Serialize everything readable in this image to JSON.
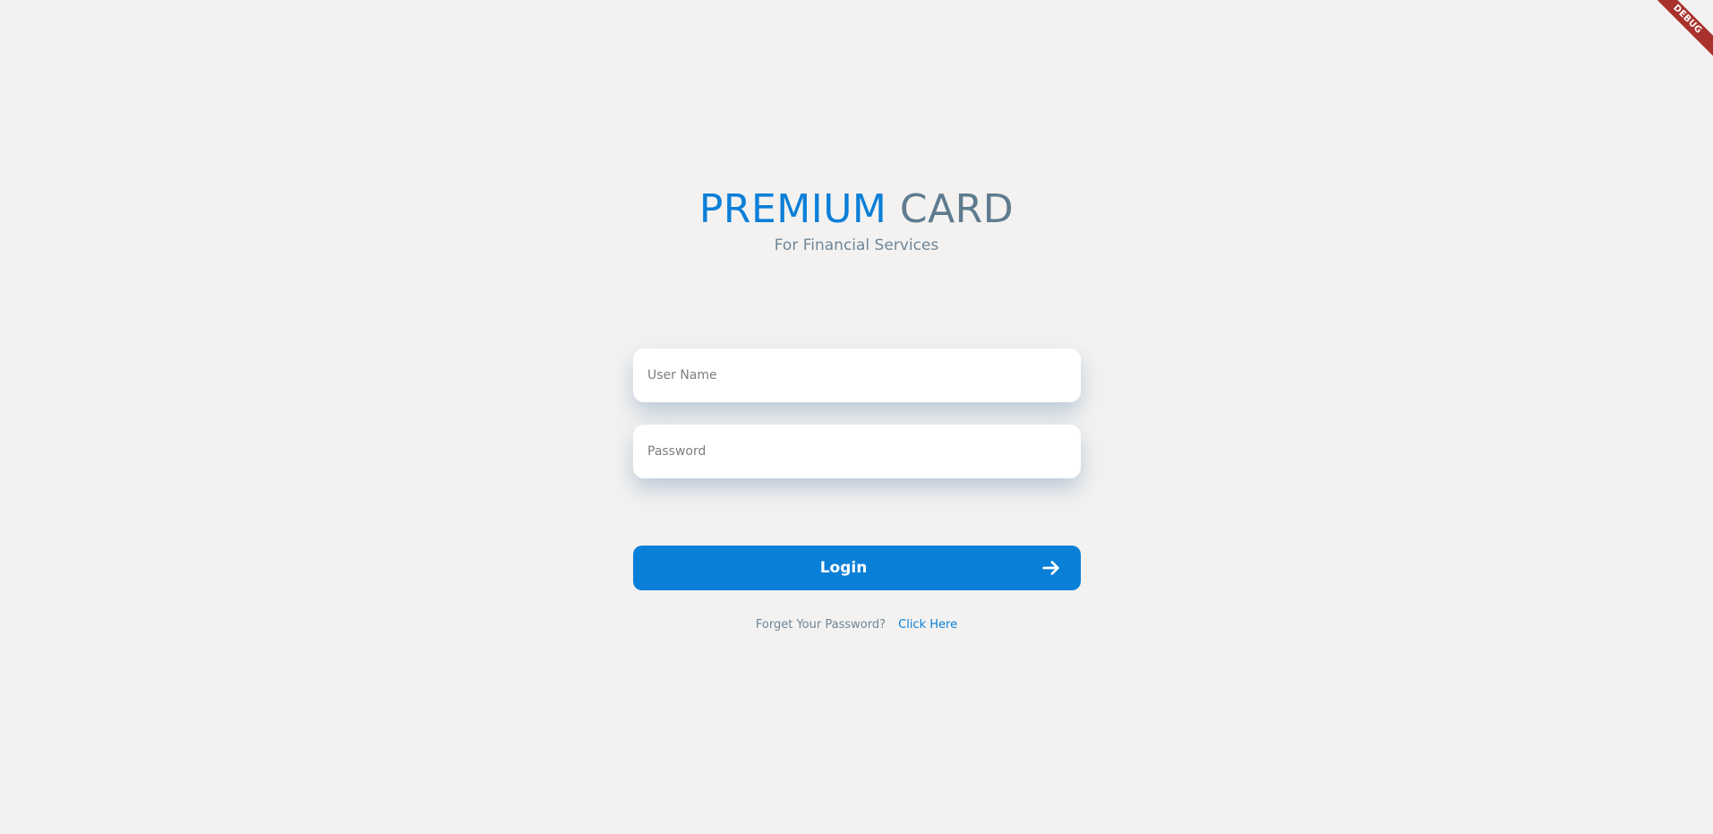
{
  "debug_banner": {
    "label": "DEBUG",
    "color": "#a8312c"
  },
  "header": {
    "title_part1": "PREMIUM",
    "title_part2": "CARD",
    "subtitle": "For Financial Services"
  },
  "form": {
    "username": {
      "placeholder": "User Name",
      "value": ""
    },
    "password": {
      "placeholder": "Password",
      "value": ""
    }
  },
  "login_button": {
    "label": "Login",
    "icon": "arrow-right-icon"
  },
  "forgot": {
    "text": "Forget Your Password?",
    "link_label": "Click Here"
  },
  "colors": {
    "accent": "#0a7fd8",
    "title_secondary": "#5f7b8e",
    "muted_text": "#6e8698",
    "background": "#f3f2f1"
  }
}
